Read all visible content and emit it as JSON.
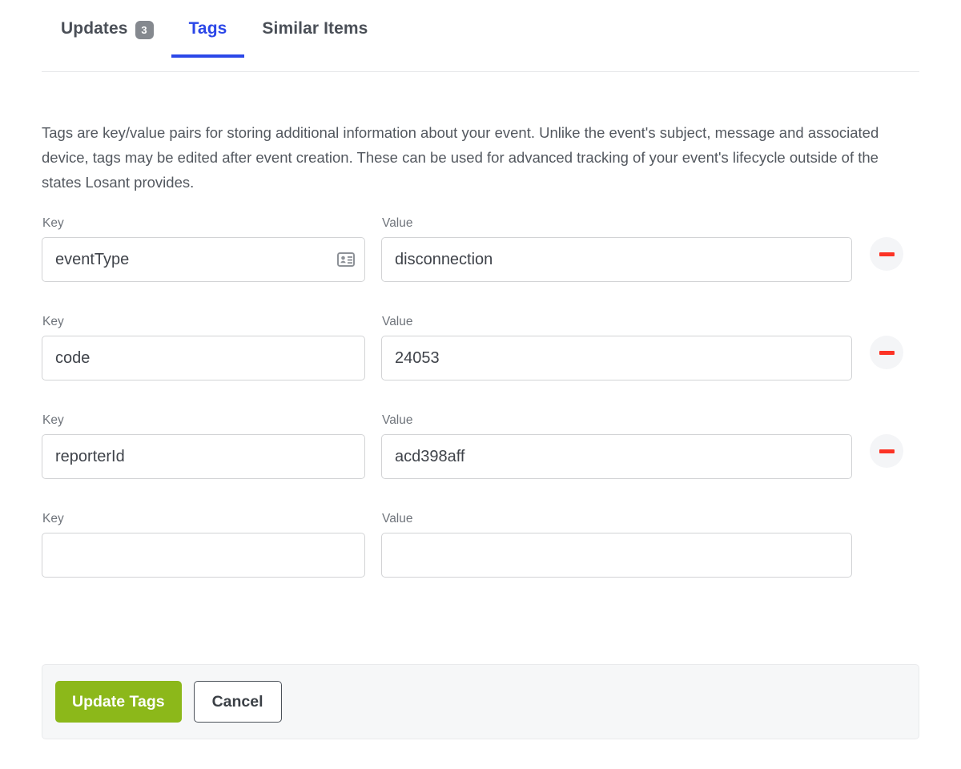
{
  "tabs": [
    {
      "label": "Updates",
      "badge": "3",
      "active": false
    },
    {
      "label": "Tags",
      "badge": null,
      "active": true
    },
    {
      "label": "Similar Items",
      "badge": null,
      "active": false
    }
  ],
  "intro": "Tags are key/value pairs for storing additional information about your event. Unlike the event's subject, message and associated device, tags may be edited after event creation. These can be used for advanced tracking of your event's lifecycle outside of the states Losant provides.",
  "labels": {
    "key": "Key",
    "value": "Value"
  },
  "rows": [
    {
      "key": "eventType",
      "value": "disconnection",
      "removable": true,
      "autofill_icon": "contact-card-icon"
    },
    {
      "key": "code",
      "value": "24053",
      "removable": true,
      "autofill_icon": null
    },
    {
      "key": "reporterId",
      "value": "acd398aff",
      "removable": true,
      "autofill_icon": null
    },
    {
      "key": "",
      "value": "",
      "removable": false,
      "autofill_icon": null
    }
  ],
  "footer": {
    "submit_label": "Update Tags",
    "cancel_label": "Cancel"
  },
  "colors": {
    "accent_blue": "#2b47e8",
    "primary_green": "#8cb81a",
    "remove_red": "#fc3325",
    "badge_gray": "#85898f",
    "footer_bg": "#f6f7f8"
  }
}
